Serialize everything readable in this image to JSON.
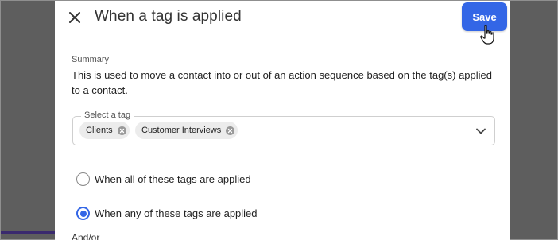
{
  "modal": {
    "title": "When a tag is applied",
    "save_label": "Save"
  },
  "summary": {
    "label": "Summary",
    "text": "This is used to move a contact into or out of an action sequence based on the tag(s) applied to a contact."
  },
  "tag_select": {
    "legend": "Select a tag",
    "tags": [
      "Clients",
      "Customer Interviews"
    ]
  },
  "options": {
    "all_label": "When all of these tags are applied",
    "any_label": "When any of these tags are applied",
    "selected": "any"
  },
  "andor_label": "And/or",
  "colors": {
    "accent": "#3366e6",
    "backdrop": "#5e5e5e"
  }
}
